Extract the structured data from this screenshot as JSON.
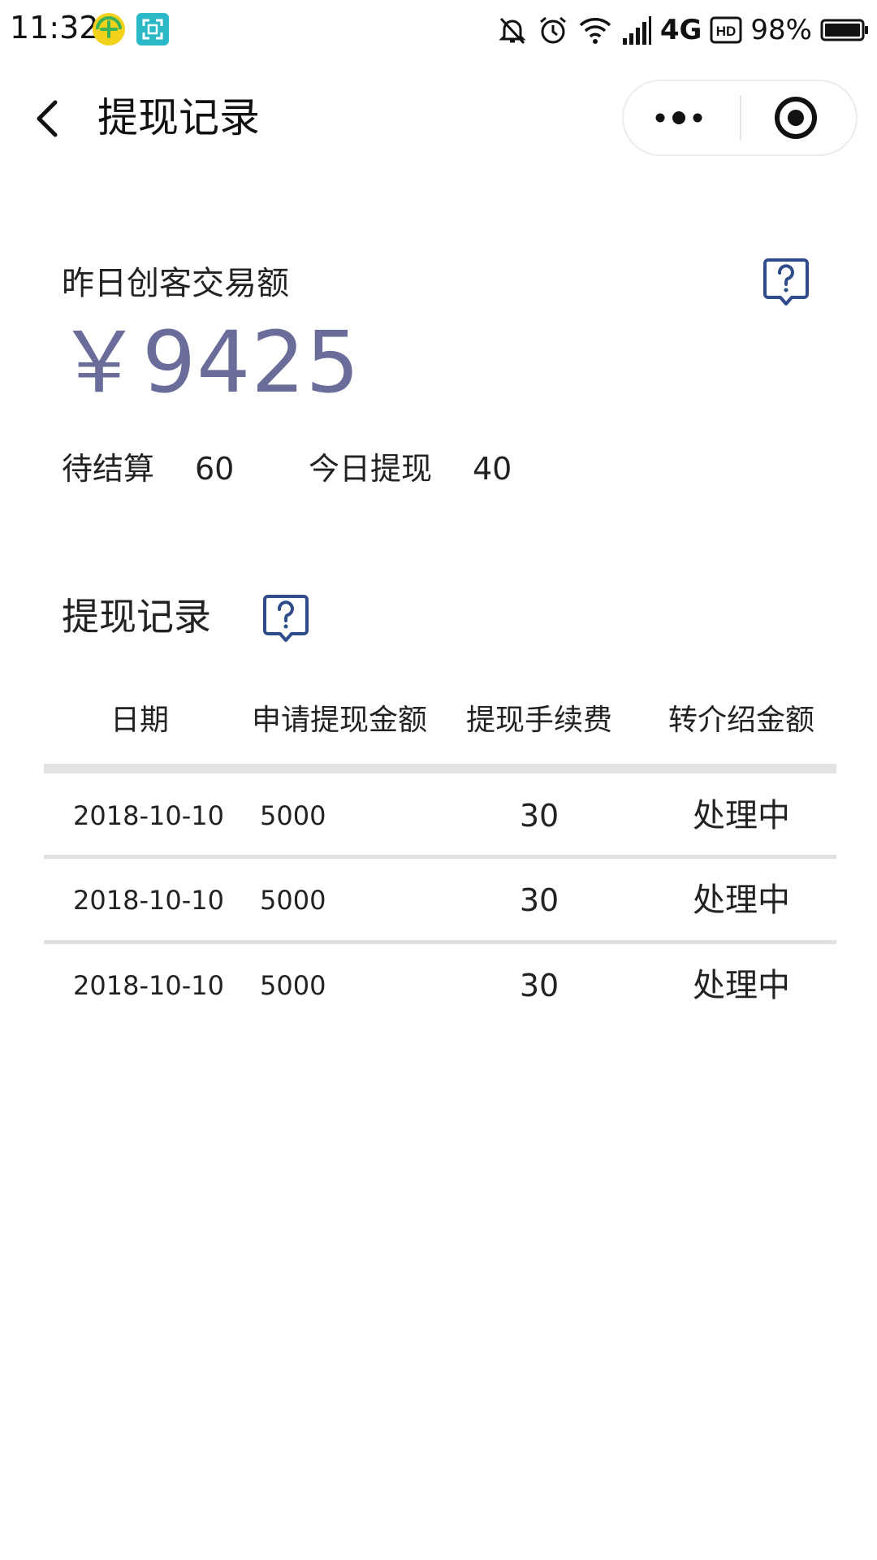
{
  "status_bar": {
    "time": "11:32",
    "network": "4G",
    "hd": "HD",
    "battery": "98%",
    "icons": [
      "plus-app-icon",
      "scan-app-icon",
      "mute-bell-icon",
      "alarm-icon",
      "wifi-icon",
      "signal-icon",
      "battery-icon"
    ]
  },
  "nav": {
    "title": "提现记录",
    "back_icon": "chevron-left-icon",
    "more_icon": "more-dots-icon",
    "close_icon": "target-close-icon"
  },
  "summary": {
    "label": "昨日创客交易额",
    "amount": "￥9425",
    "help_icon": "question-bubble-icon",
    "pending_label": "待结算",
    "pending_value": "60",
    "today_label": "今日提现",
    "today_value": "40"
  },
  "records": {
    "title": "提现记录",
    "help_icon": "question-bubble-icon",
    "columns": [
      "日期",
      "申请提现金额",
      "提现手续费",
      "转介绍金额"
    ],
    "rows": [
      {
        "date": "2018-10-10",
        "amount": "5000",
        "fee": "30",
        "status": "处理中"
      },
      {
        "date": "2018-10-10",
        "amount": "5000",
        "fee": "30",
        "status": "处理中"
      },
      {
        "date": "2018-10-10",
        "amount": "5000",
        "fee": "30",
        "status": "处理中"
      }
    ]
  },
  "colors": {
    "amount": "#6a6d99",
    "help_icon": "#2f4c8a",
    "divider": "#e3e3e3"
  }
}
